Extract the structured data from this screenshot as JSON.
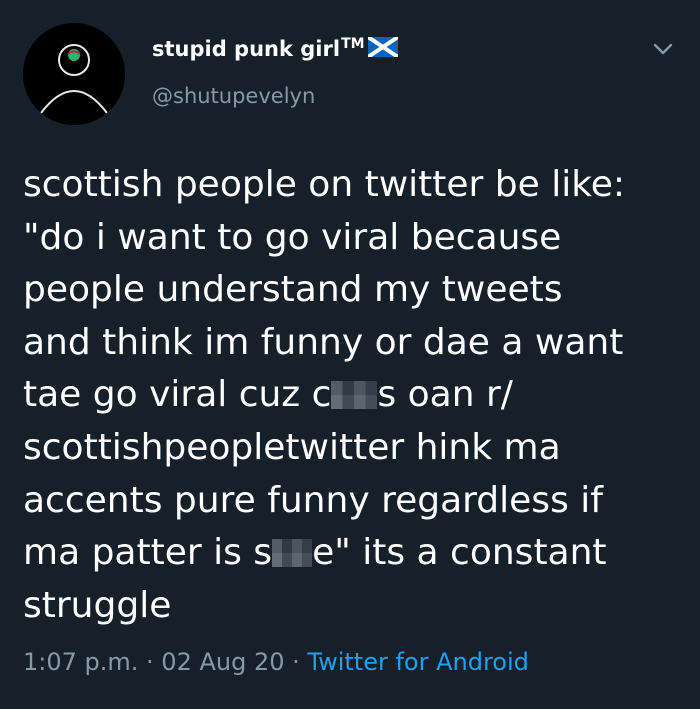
{
  "user": {
    "display_name": "stupid punk girl",
    "trademark": "TM",
    "flag_icon": "scotland-flag-icon",
    "handle": "@shutupevelyn"
  },
  "menu_icon": "chevron-down-icon",
  "tweet": {
    "lines": [
      "scottish people on twitter be like:",
      "\"do i want to go viral because",
      "people understand my tweets",
      "and think im funny or dae a want",
      [
        "tae go viral cuz c",
        "s oan r/"
      ],
      "scottishpeopletwitter hink ma",
      "accents pure funny regardless if",
      [
        "ma patter is s",
        "e\" its a constant"
      ],
      "struggle"
    ]
  },
  "meta": {
    "time": "1:07 p.m.",
    "sep1": " · ",
    "date": "02 Aug 20",
    "sep2": " · ",
    "source": "Twitter for Android"
  },
  "colors": {
    "background": "#15202b",
    "text": "#ffffff",
    "secondary": "#8899a6",
    "link": "#1da1f2",
    "flag_blue": "#0065bd"
  }
}
